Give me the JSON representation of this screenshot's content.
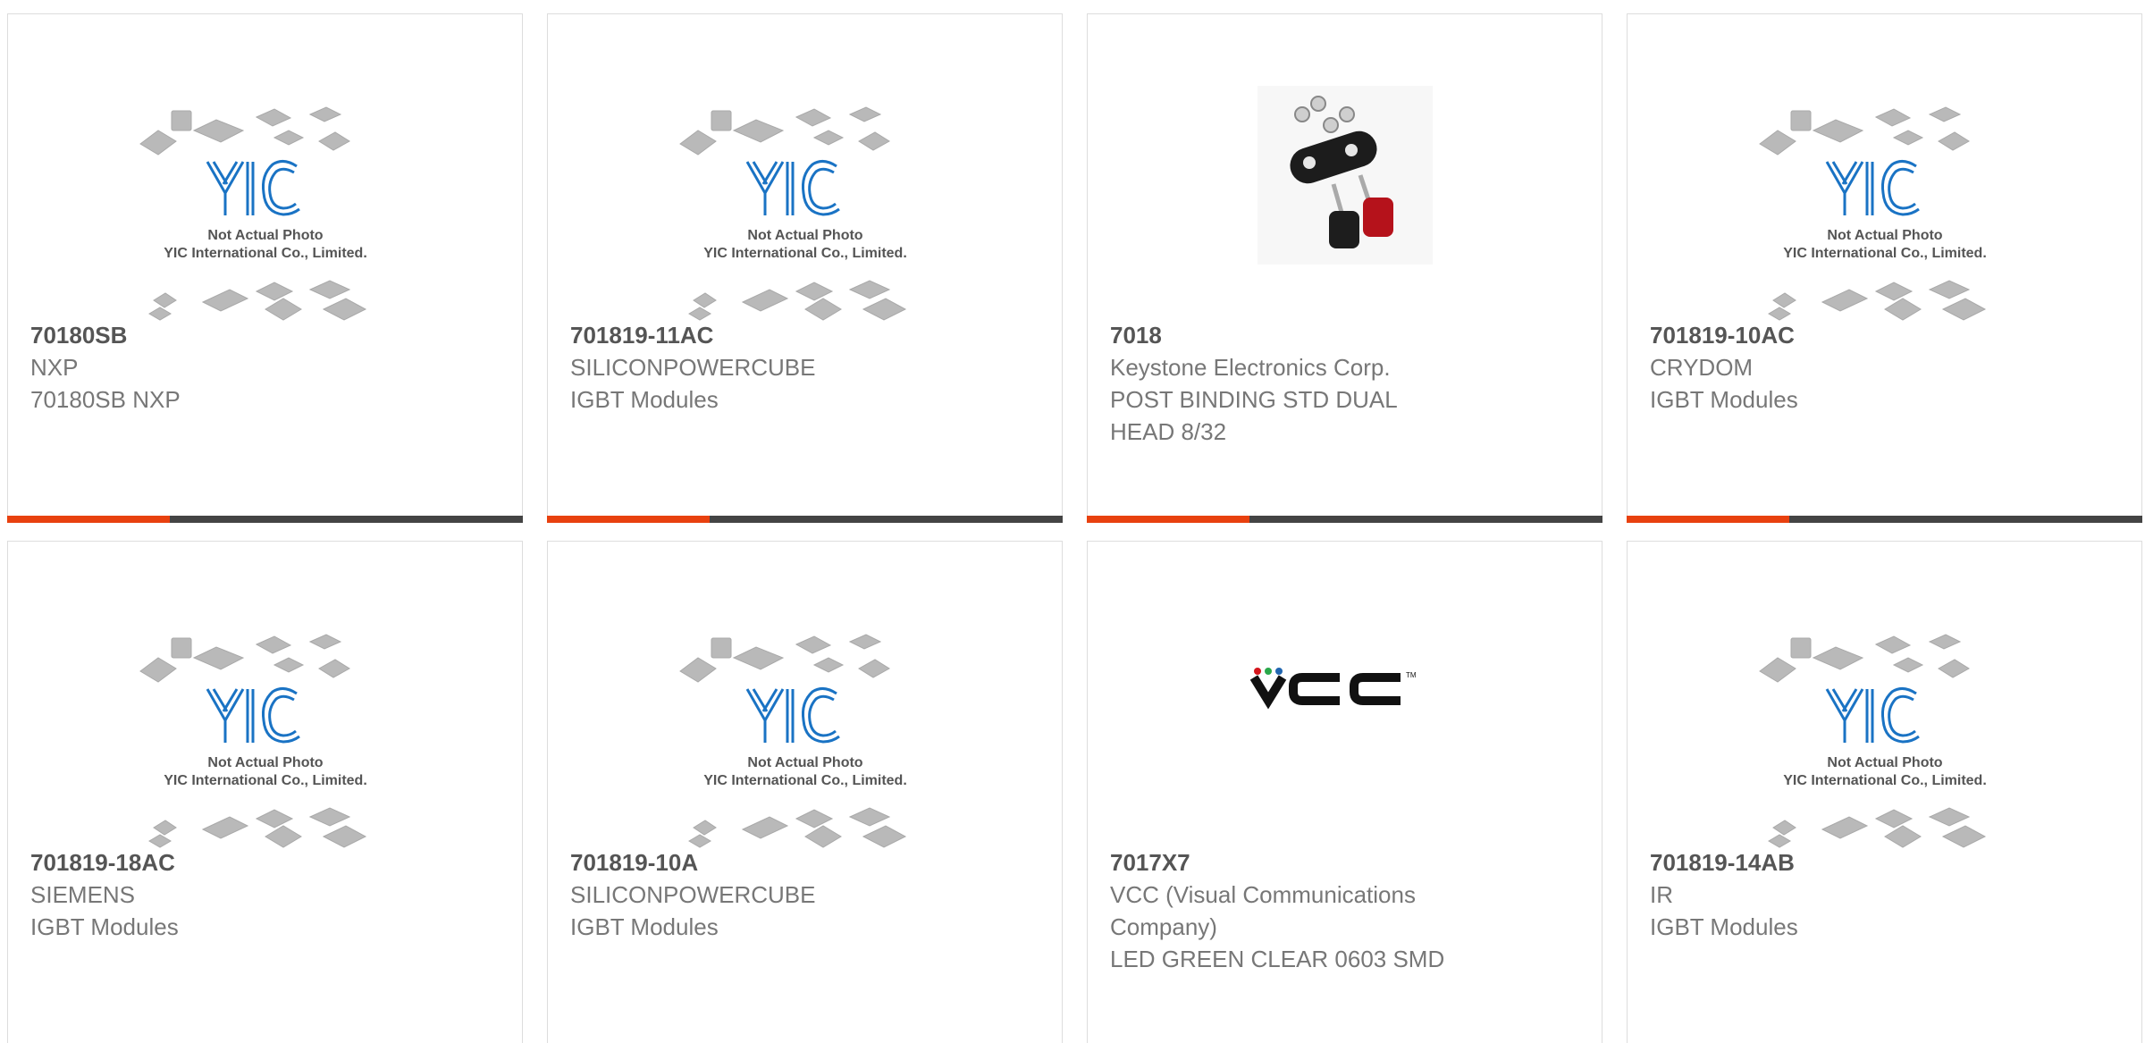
{
  "placeholder": {
    "line1": "Not Actual Photo",
    "line2": "YIC International Co., Limited."
  },
  "products": [
    {
      "part": "70180SB",
      "line1": "NXP",
      "line2": "70180SB NXP",
      "line3": "",
      "image": "placeholder"
    },
    {
      "part": "701819-11AC",
      "line1": "SILICONPOWERCUBE",
      "line2": "IGBT Modules",
      "line3": "",
      "image": "placeholder"
    },
    {
      "part": "7018",
      "line1": "Keystone Electronics Corp.",
      "line2": "POST BINDING STD DUAL",
      "line3": "HEAD 8/32",
      "image": "binding-post-photo"
    },
    {
      "part": "701819-10AC",
      "line1": "CRYDOM",
      "line2": "IGBT Modules",
      "line3": "",
      "image": "placeholder"
    },
    {
      "part": "701819-18AC",
      "line1": "SIEMENS",
      "line2": "IGBT Modules",
      "line3": "",
      "image": "placeholder"
    },
    {
      "part": "701819-10A",
      "line1": "SILICONPOWERCUBE",
      "line2": "IGBT Modules",
      "line3": "",
      "image": "placeholder"
    },
    {
      "part": "7017X7",
      "line1": "VCC (Visual Communications",
      "line2": "Company)",
      "line3": "LED GREEN CLEAR 0603 SMD",
      "image": "vcc-logo"
    },
    {
      "part": "701819-14AB",
      "line1": "IR",
      "line2": "IGBT Modules",
      "line3": "",
      "image": "placeholder"
    }
  ],
  "logos": {
    "yic": "YIC",
    "vcc": "VCC"
  },
  "colors": {
    "accent": "#e8410f",
    "bar": "#444444",
    "yic_blue": "#1a73c4"
  }
}
